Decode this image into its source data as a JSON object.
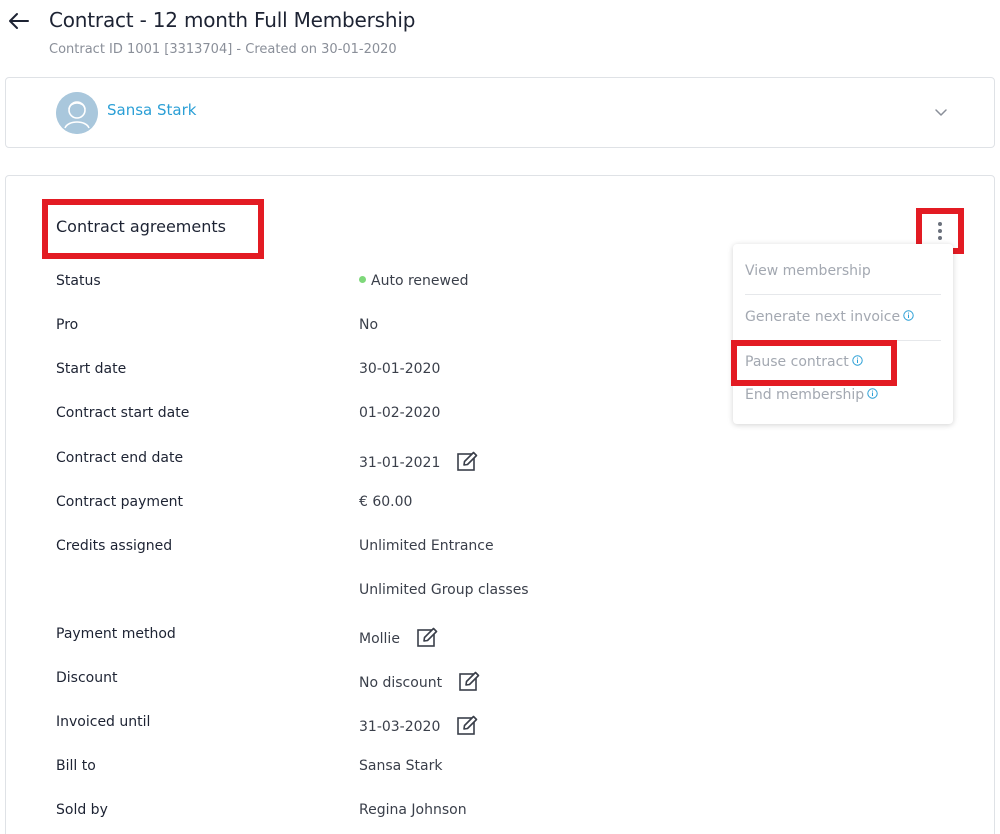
{
  "header": {
    "title": "Contract - 12 month Full Membership",
    "subtitle": "Contract ID 1001 [3313704] - Created on 30-01-2020"
  },
  "member": {
    "name": "Sansa Stark"
  },
  "contract": {
    "section_title": "Contract agreements",
    "rows": [
      {
        "label": "Status",
        "value": "Auto renewed"
      },
      {
        "label": "Pro",
        "value": "No"
      },
      {
        "label": "Start date",
        "value": "30-01-2020"
      },
      {
        "label": "Contract start date",
        "value": "01-02-2020"
      },
      {
        "label": "Contract end date",
        "value": "31-01-2021"
      },
      {
        "label": "Contract payment",
        "value": "€ 60.00"
      },
      {
        "label": "Credits assigned",
        "value": "Unlimited Entrance"
      },
      {
        "label": "",
        "value": "Unlimited Group classes"
      },
      {
        "label": "Payment method",
        "value": "Mollie"
      },
      {
        "label": "Discount",
        "value": "No discount"
      },
      {
        "label": "Invoiced until",
        "value": "31-03-2020"
      },
      {
        "label": "Bill to",
        "value": "Sansa Stark"
      },
      {
        "label": "Sold by",
        "value": "Regina Johnson"
      }
    ]
  },
  "menu": {
    "items": [
      {
        "label": "View membership"
      },
      {
        "label": "Generate next invoice"
      },
      {
        "label": "Pause contract"
      },
      {
        "label": "End membership"
      }
    ]
  },
  "colors": {
    "accent": "#2b9fd6",
    "highlight": "#e31b23",
    "status_active": "#7ed87a"
  },
  "icons": [
    "back-arrow-icon",
    "avatar-icon",
    "chevron-down-icon",
    "kebab-menu-icon",
    "edit-icon",
    "info-icon"
  ]
}
